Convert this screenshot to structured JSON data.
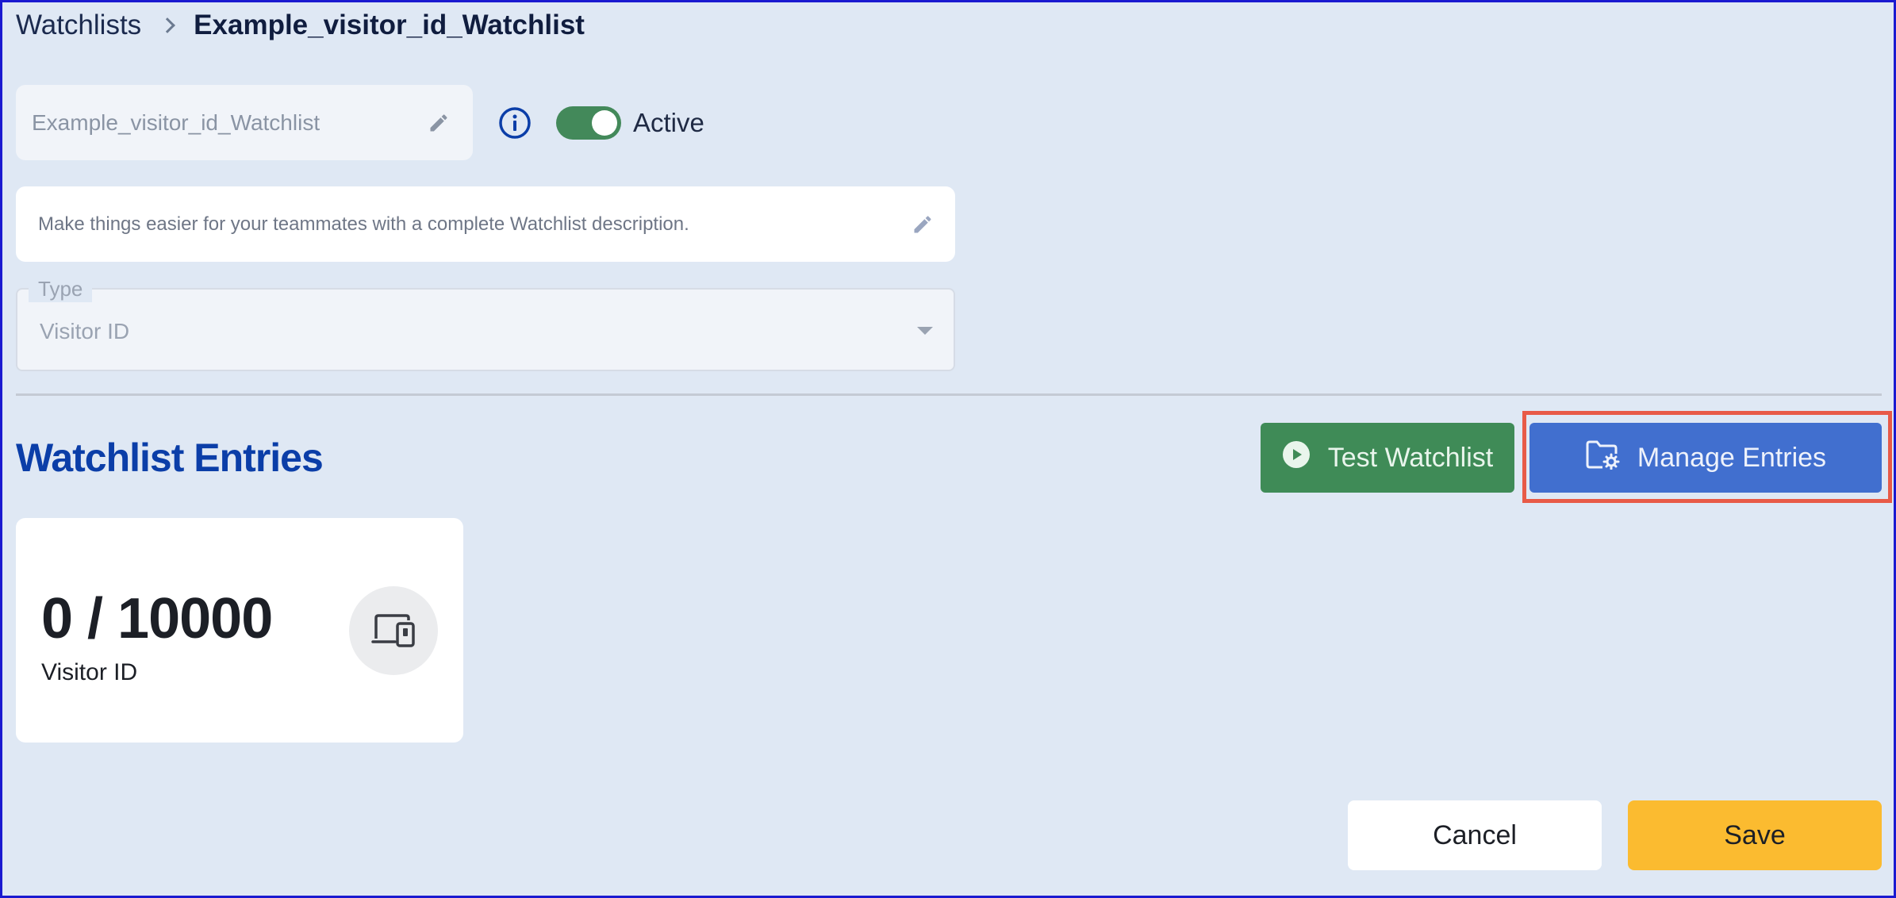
{
  "breadcrumb": {
    "root": "Watchlists",
    "current": "Example_visitor_id_Watchlist"
  },
  "watchlist": {
    "name_value": "Example_visitor_id_Watchlist",
    "active_label": "Active",
    "active": true,
    "description_placeholder": "Make things easier for your teammates with a complete Watchlist description.",
    "type_label": "Type",
    "type_value": "Visitor ID"
  },
  "entries": {
    "title": "Watchlist Entries",
    "test_button": "Test Watchlist",
    "manage_button": "Manage Entries",
    "count_text": "0 / 10000",
    "count_label": "Visitor ID"
  },
  "footer": {
    "cancel_button": "Cancel",
    "save_button": "Save"
  },
  "icons": {
    "edit_name": "pencil-icon",
    "info": "info-icon",
    "edit_description": "pencil-icon",
    "type_dropdown": "caret-down-icon",
    "test": "play-circle-icon",
    "manage": "folder-gear-icon",
    "device": "devices-icon"
  },
  "colors": {
    "background": "#dfe8f4",
    "title_blue": "#0b3ea8",
    "toggle_green": "#43895a",
    "test_green": "#3f8b57",
    "manage_blue": "#416fcf",
    "highlight_red": "#e85a47",
    "save_yellow": "#fbbb30"
  }
}
